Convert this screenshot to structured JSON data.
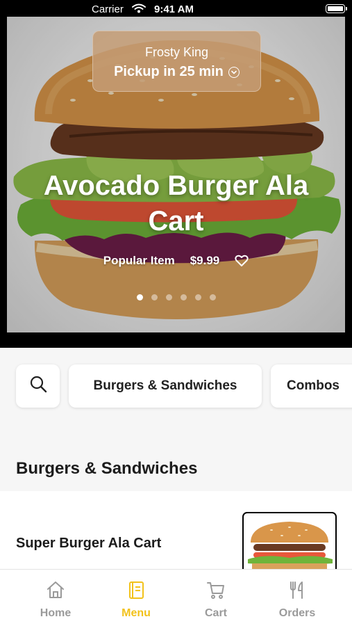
{
  "status_bar": {
    "carrier": "Carrier",
    "time": "9:41 AM"
  },
  "hero": {
    "store_name": "Frosty King",
    "pickup_text": "Pickup in 25 min",
    "item_title": "Avocado Burger Ala Cart",
    "tag": "Popular Item",
    "price": "$9.99",
    "carousel": {
      "total": 6,
      "active_index": 0
    }
  },
  "categories": {
    "search_icon": "search-icon",
    "items": [
      "Burgers & Sandwiches",
      "Combos"
    ]
  },
  "section": {
    "title": "Burgers & Sandwiches",
    "items": [
      {
        "name": "Super Burger Ala Cart"
      }
    ]
  },
  "tab_bar": {
    "tabs": [
      {
        "label": "Home",
        "icon": "home-icon"
      },
      {
        "label": "Menu",
        "icon": "menu-book-icon"
      },
      {
        "label": "Cart",
        "icon": "cart-icon"
      },
      {
        "label": "Orders",
        "icon": "fork-knife-icon"
      }
    ],
    "active": "Menu"
  },
  "colors": {
    "accent": "#f2c21b",
    "inactive_tab": "#9a9a9a",
    "pickup_card": "#c49c74"
  }
}
